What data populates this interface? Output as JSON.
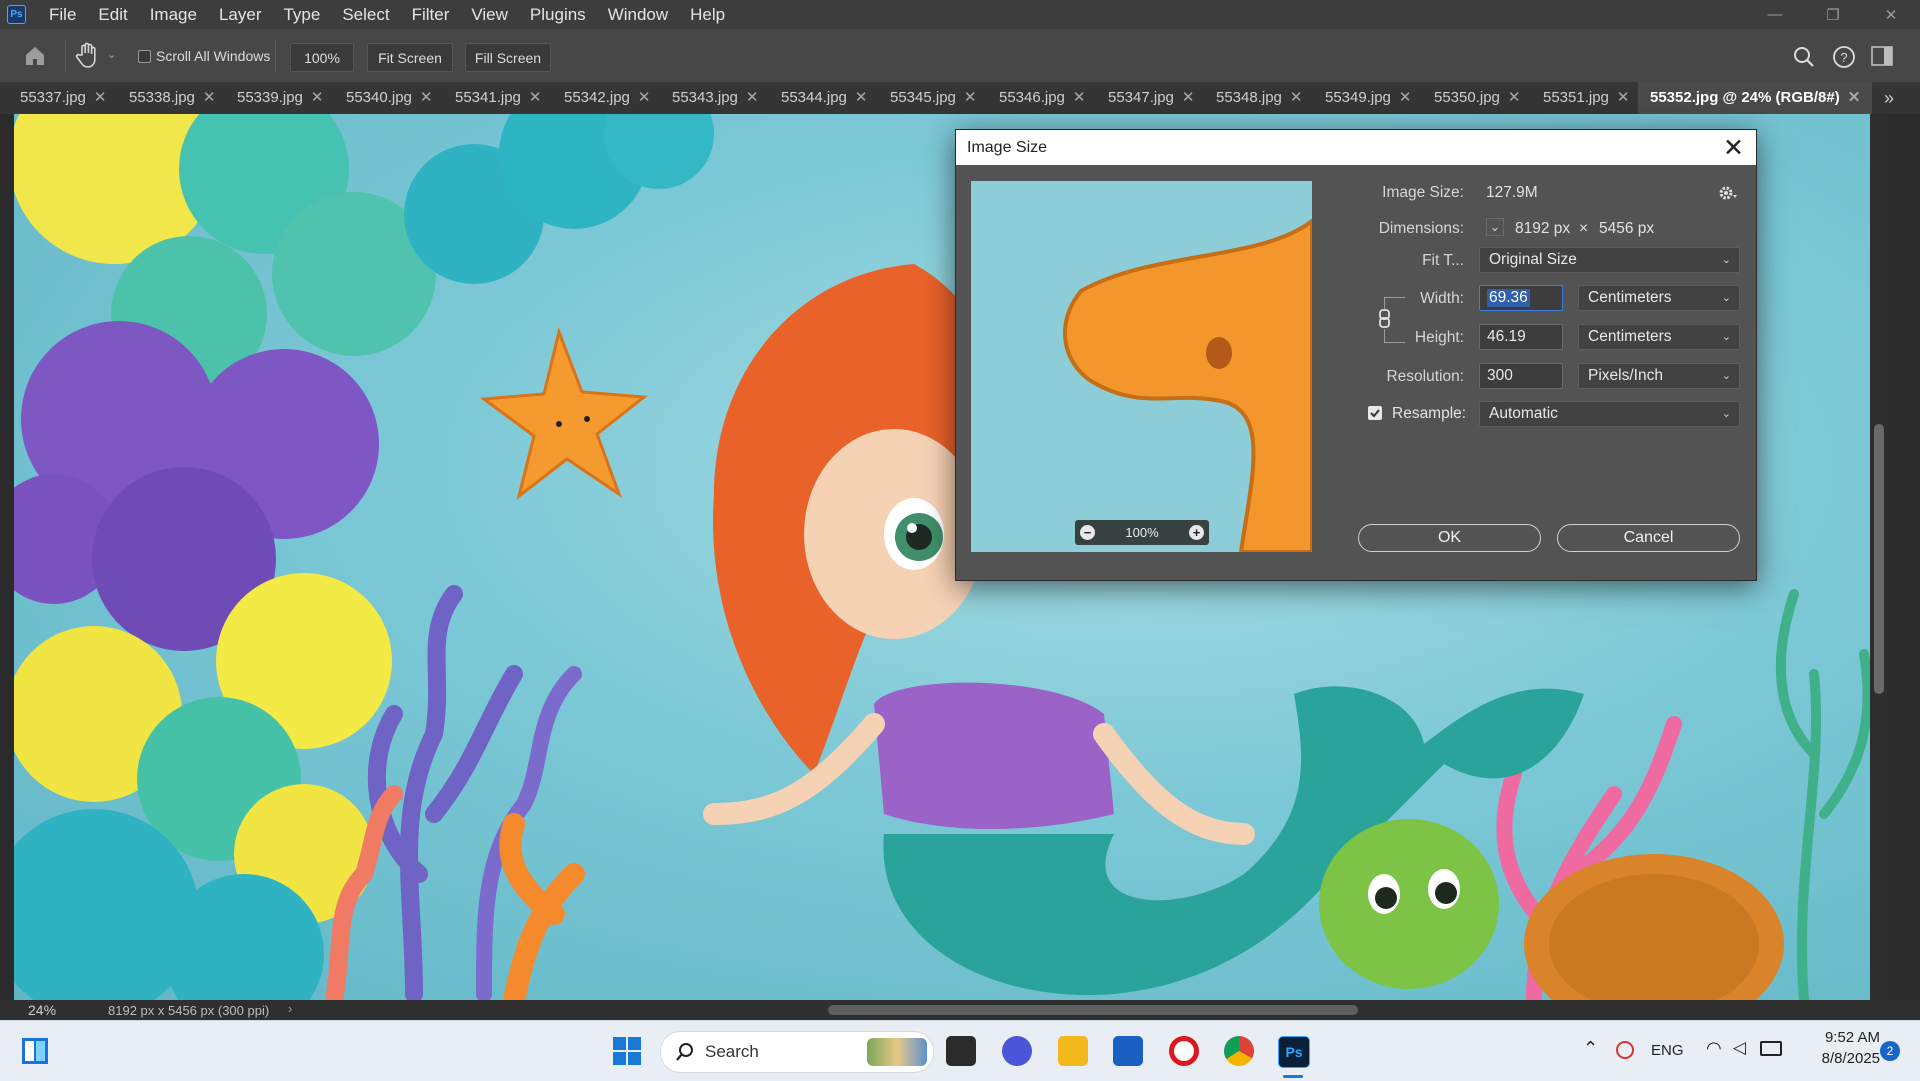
{
  "app": {
    "logo": "Ps"
  },
  "menu": [
    "File",
    "Edit",
    "Image",
    "Layer",
    "Type",
    "Select",
    "Filter",
    "View",
    "Plugins",
    "Window",
    "Help"
  ],
  "window_controls": {
    "minimize": "—",
    "restore": "❐",
    "close": "✕"
  },
  "options_bar": {
    "scroll_all_windows": {
      "label": "Scroll All Windows",
      "checked": false
    },
    "zoom_value": "100%",
    "fit_screen": "Fit Screen",
    "fill_screen": "Fill Screen"
  },
  "tabs": [
    {
      "label": "55337.jpg",
      "active": false
    },
    {
      "label": "55338.jpg",
      "active": false
    },
    {
      "label": "55339.jpg",
      "active": false
    },
    {
      "label": "55340.jpg",
      "active": false
    },
    {
      "label": "55341.jpg",
      "active": false
    },
    {
      "label": "55342.jpg",
      "active": false
    },
    {
      "label": "55343.jpg",
      "active": false
    },
    {
      "label": "55344.jpg",
      "active": false
    },
    {
      "label": "55345.jpg",
      "active": false
    },
    {
      "label": "55346.jpg",
      "active": false
    },
    {
      "label": "55347.jpg",
      "active": false
    },
    {
      "label": "55348.jpg",
      "active": false
    },
    {
      "label": "55349.jpg",
      "active": false
    },
    {
      "label": "55350.jpg",
      "active": false
    },
    {
      "label": "55351.jpg",
      "active": false
    },
    {
      "label": "55352.jpg @ 24% (RGB/8#)",
      "active": true
    }
  ],
  "tab_close_glyph": "✕",
  "tab_overflow": "»",
  "dialog": {
    "title": "Image Size",
    "close": "✕",
    "image_size_label": "Image Size:",
    "image_size_value": "127.9M",
    "dimensions_label": "Dimensions:",
    "dimensions_width": "8192 px",
    "dimensions_times": "×",
    "dimensions_height": "5456 px",
    "fit_to_label": "Fit T...",
    "fit_to_value": "Original Size",
    "width_label": "Width:",
    "width_value": "69.36",
    "width_unit": "Centimeters",
    "height_label": "Height:",
    "height_value": "46.19",
    "height_unit": "Centimeters",
    "resolution_label": "Resolution:",
    "resolution_value": "300",
    "resolution_unit": "Pixels/Inch",
    "resample_label": "Resample:",
    "resample_checked": true,
    "resample_value": "Automatic",
    "preview_zoom": "100%",
    "ok": "OK",
    "cancel": "Cancel"
  },
  "status_bar": {
    "zoom": "24%",
    "info": "8192 px x 5456 px (300 ppi)"
  },
  "taskbar": {
    "search_placeholder": "Search",
    "language": "ENG",
    "time": "9:52 AM",
    "date": "8/8/2025",
    "notification_count": "2"
  },
  "colors": {
    "accent": "#3b7de0",
    "highlight": "#2f5fa8",
    "canvas_bg": "#7cc8d6",
    "starfish": "#f59a2e",
    "hair": "#e8622a"
  }
}
